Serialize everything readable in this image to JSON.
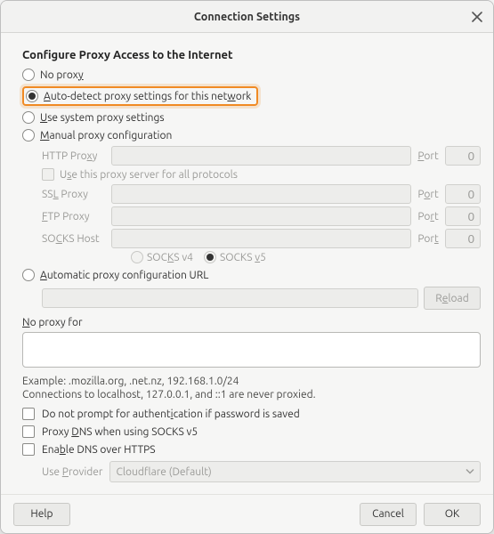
{
  "titlebar": {
    "title": "Connection Settings"
  },
  "heading": "Configure Proxy Access to the Internet",
  "radios": {
    "no_proxy": {
      "label_pre": "No prox",
      "label_u": "y",
      "label_post": ""
    },
    "auto_detect": {
      "label_pre": "",
      "label_u": "A",
      "label_post": "uto-detect proxy settings for this net",
      "label_u2": "w",
      "label_post2": "ork"
    },
    "system": {
      "label_pre": "",
      "label_u": "U",
      "label_post": "se system proxy settings"
    },
    "manual": {
      "label_pre": "",
      "label_u": "M",
      "label_post": "anual proxy configuration"
    },
    "auto_url": {
      "label_pre": "",
      "label_u": "A",
      "label_post": "utomatic proxy configuration URL"
    }
  },
  "manual": {
    "http_label": "HTTP Proxy",
    "ssl_label": "SSL Proxy",
    "ftp_label": "FTP Proxy",
    "socks_label": "SOCKS Host",
    "port_label": "Port",
    "port_value": "0",
    "use_for_all": "Use this proxy server for all protocols",
    "socks4": "SOCKS v4",
    "socks5": "SOCKS v5"
  },
  "auto_url": {
    "reload": "Reload"
  },
  "no_proxy_for": {
    "label_pre": "",
    "label_u": "N",
    "label_post": "o proxy for",
    "example": "Example: .mozilla.org, .net.nz, 192.168.1.0/24",
    "note": "Connections to localhost, 127.0.0.1, and ::1 are never proxied."
  },
  "checks": {
    "no_prompt": "Do not prompt for authentication if password is saved",
    "proxy_dns": "Proxy DNS when using SOCKS v5",
    "enable_doh": "Enable DNS over HTTPS"
  },
  "provider": {
    "label": "Use Provider",
    "value": "Cloudflare (Default)"
  },
  "footer": {
    "help": "Help",
    "cancel": "Cancel",
    "ok": "OK"
  }
}
